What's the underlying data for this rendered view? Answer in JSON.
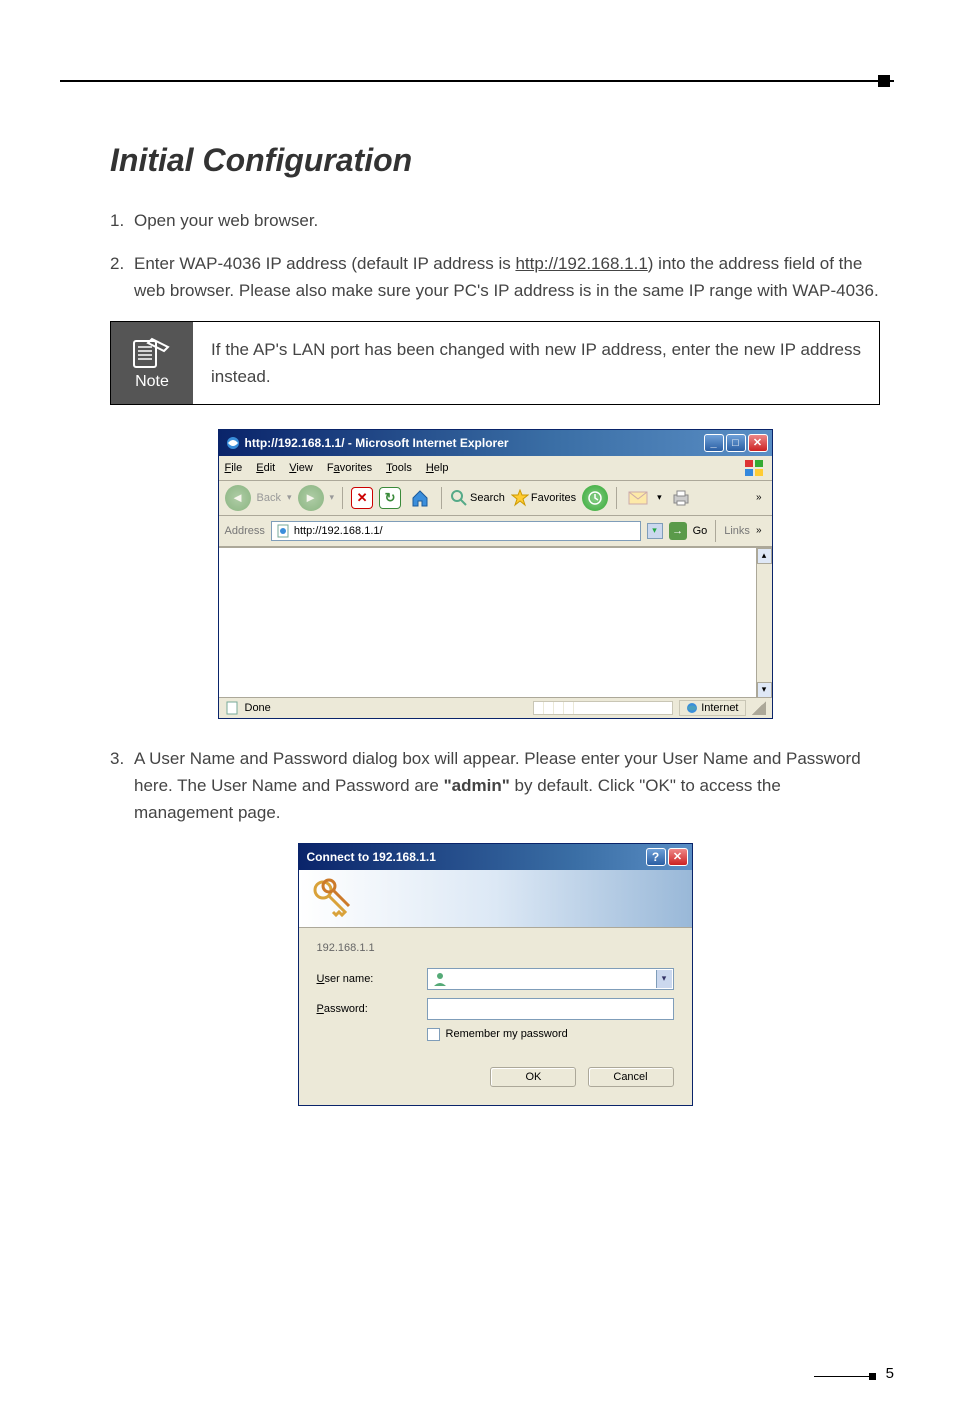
{
  "page": {
    "number": "5",
    "heading": "Initial Configuration"
  },
  "steps": {
    "s1": {
      "num": "1.",
      "text": "Open your web browser."
    },
    "s2": {
      "num": "2.",
      "prefix": "Enter WAP-4036 IP address (default IP address is ",
      "url": "http://192.168.1.1",
      "suffix": ") into the address field of the web browser. Please also make sure your PC's IP address is in the same IP range with WAP-4036."
    },
    "s3": {
      "num": "3.",
      "prefix": "A User Name and Password dialog box will appear. Please enter your User Name and Password here. The User Name and Password are ",
      "bold": "\"admin\"",
      "suffix": " by default. Click \"OK\" to access the management page."
    }
  },
  "note": {
    "label": "Note",
    "text": "If the AP's LAN port has been changed with new IP address, enter the new IP address instead."
  },
  "ie": {
    "title": "http://192.168.1.1/ - Microsoft Internet Explorer",
    "menu": {
      "file": "File",
      "edit": "Edit",
      "view": "View",
      "favorites": "Favorites",
      "tools": "Tools",
      "help": "Help"
    },
    "toolbar": {
      "back": "Back",
      "search": "Search",
      "favorites": "Favorites"
    },
    "addressLabel": "Address",
    "addressValue": "http://192.168.1.1/",
    "go": "Go",
    "links": "Links",
    "status": {
      "done": "Done",
      "zone": "Internet"
    }
  },
  "auth": {
    "title": "Connect to 192.168.1.1",
    "server": "192.168.1.1",
    "userLabel": "User name:",
    "passLabel": "Password:",
    "remember": "Remember my password",
    "ok": "OK",
    "cancel": "Cancel"
  }
}
